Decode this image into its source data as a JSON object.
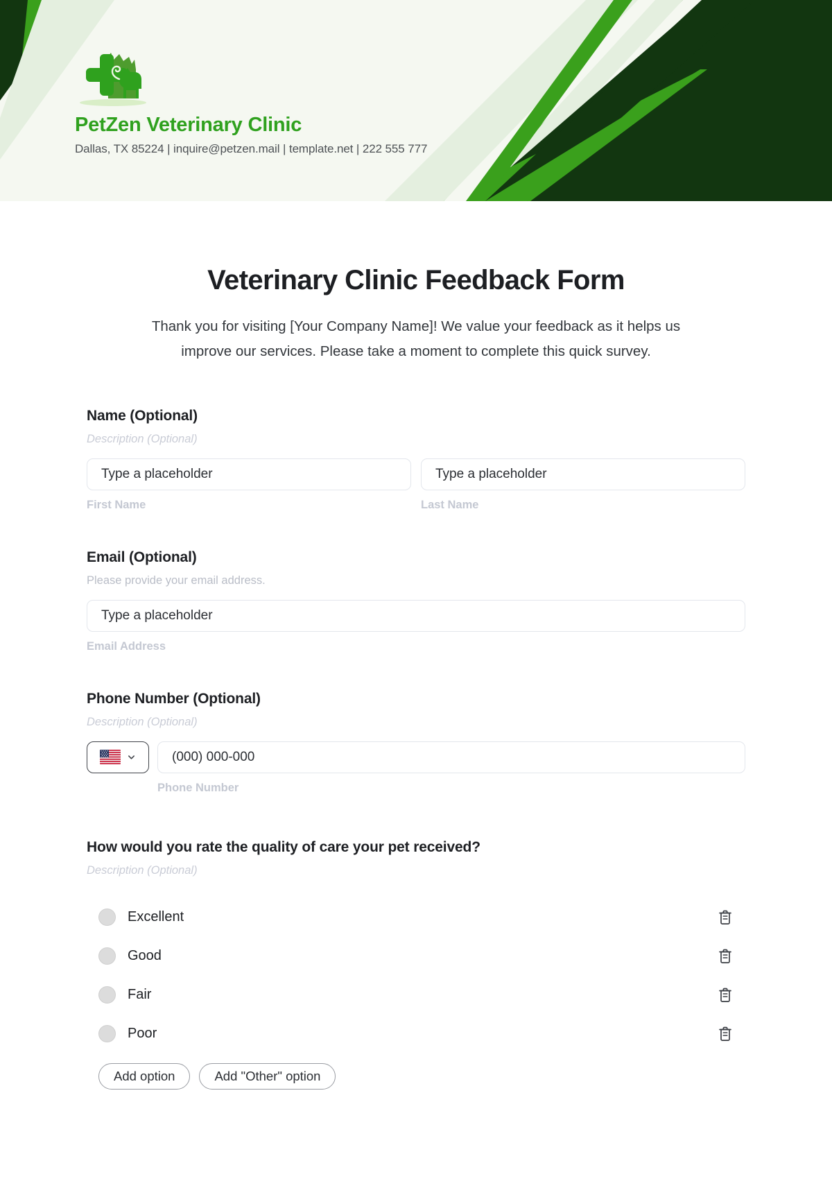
{
  "header": {
    "brand_name": "PetZen Veterinary Clinic",
    "contact_line": "Dallas, TX 85224 | inquire@petzen.mail | template.net | 222 555 777",
    "colors": {
      "banner_bg": "#f5f8f1",
      "dark_green": "#123610",
      "bright_green": "#3aa01c",
      "pale_green": "#e4efdf",
      "brand_green": "#2fa11e"
    }
  },
  "form": {
    "title": "Veterinary Clinic Feedback Form",
    "intro": "Thank you for visiting [Your Company Name]! We value your feedback as it helps us improve our services. Please take a moment to complete this quick survey.",
    "fields": [
      {
        "label": "Name (Optional)",
        "description": "Description (Optional)",
        "inputs": [
          {
            "placeholder": "Type a placeholder",
            "sub_label": "First Name"
          },
          {
            "placeholder": "Type a placeholder",
            "sub_label": "Last Name"
          }
        ]
      },
      {
        "label": "Email (Optional)",
        "description": "Please provide your email address.",
        "inputs": [
          {
            "placeholder": "Type a placeholder",
            "sub_label": "Email Address"
          }
        ]
      },
      {
        "label": "Phone Number (Optional)",
        "description": "Description (Optional)",
        "country_flag": "us-flag-icon",
        "inputs": [
          {
            "placeholder": "(000) 000-000",
            "sub_label": "Phone Number"
          }
        ]
      }
    ],
    "question": {
      "label": "How would you rate the quality of care your pet received?",
      "description": "Description (Optional)",
      "options": [
        {
          "label": "Excellent"
        },
        {
          "label": "Good"
        },
        {
          "label": "Fair"
        },
        {
          "label": "Poor"
        }
      ],
      "buttons": {
        "add_option": "Add option",
        "add_other_option": "Add \"Other\" option"
      }
    }
  }
}
